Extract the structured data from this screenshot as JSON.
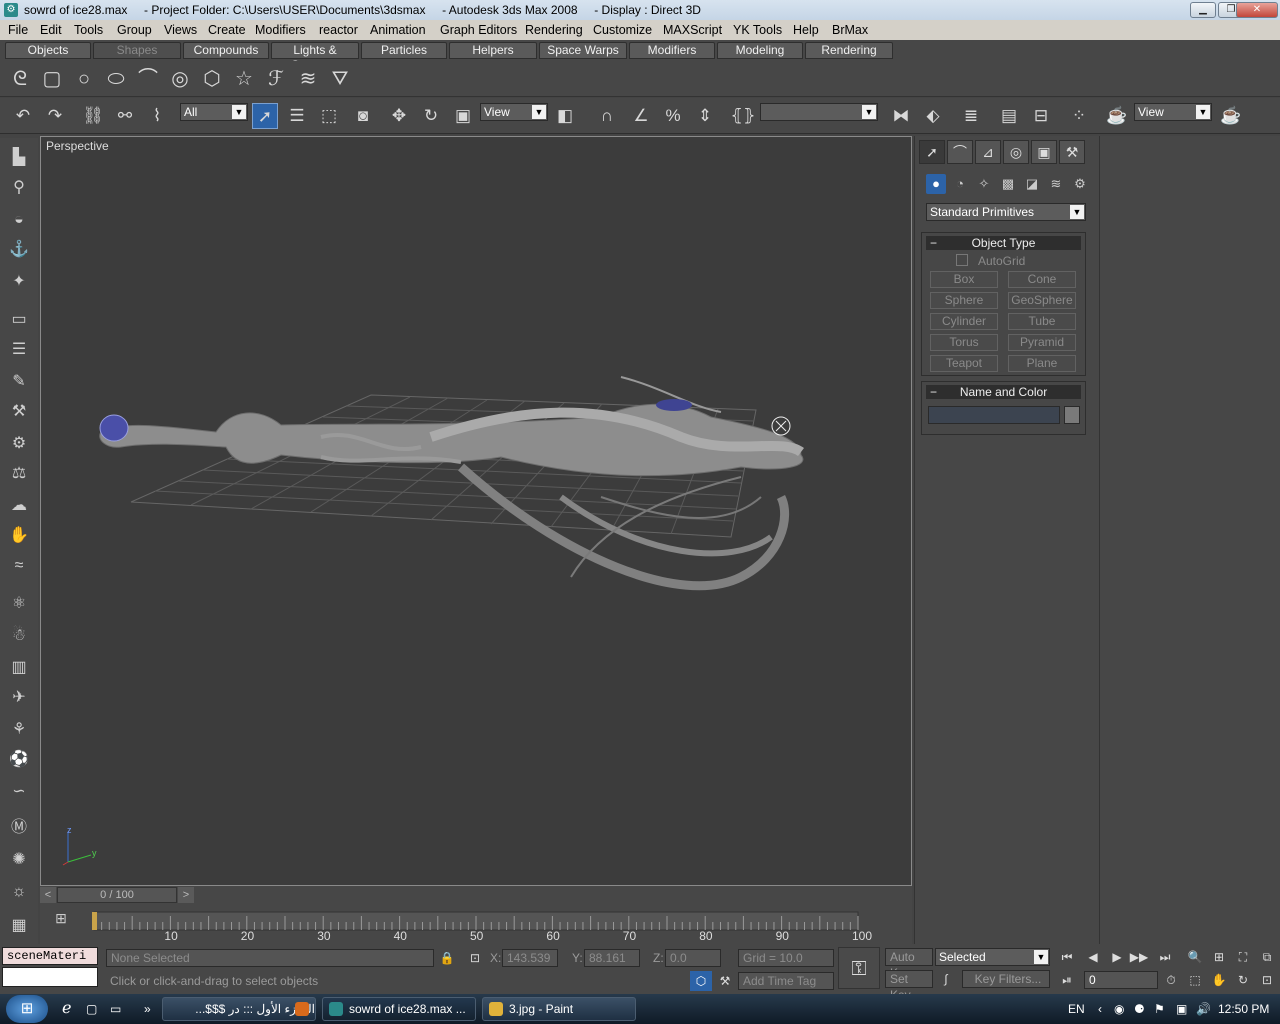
{
  "window": {
    "title": "sowrd of ice28.max     - Project Folder: C:\\Users\\USER\\Documents\\3dsmax     - Autodesk 3ds Max 2008     - Display : Direct 3D",
    "minimize_icon": "minimize-icon",
    "maximize_icon": "restore-icon",
    "close_icon": "close-icon"
  },
  "menu": [
    "File",
    "Edit",
    "Tools",
    "Group",
    "Views",
    "Create",
    "Modifiers",
    "reactor",
    "Animation",
    "Graph Editors",
    "Rendering",
    "Customize",
    "MAXScript",
    "YK Tools",
    "Help",
    "BrMax"
  ],
  "tabs": [
    "Objects",
    "Shapes",
    "Compounds",
    "Lights & Cameras",
    "Particles",
    "Helpers",
    "Space Warps",
    "Modifiers",
    "Modeling",
    "Rendering"
  ],
  "active_tab": "Shapes",
  "toolbar": {
    "selection_filter": "All",
    "ref_coord": "View",
    "named_selection": "",
    "render_view": "View"
  },
  "viewport": {
    "label": "Perspective",
    "axis_x": "y",
    "axis_z": "z"
  },
  "command_panel": {
    "category_dropdown": "Standard Primitives",
    "object_type_title": "Object Type",
    "autogrid_label": "AutoGrid",
    "object_buttons": [
      "Box",
      "Cone",
      "Sphere",
      "GeoSphere",
      "Cylinder",
      "Tube",
      "Torus",
      "Pyramid",
      "Teapot",
      "Plane"
    ],
    "name_color_title": "Name and Color",
    "name_value": "",
    "collapse_symbol": "−"
  },
  "time_slider": {
    "label": "0 / 100",
    "frame_fraction": 0.0
  },
  "track_ticks": [
    "10",
    "20",
    "30",
    "40",
    "50",
    "60",
    "70",
    "80",
    "90",
    "100"
  ],
  "status": {
    "script_label": "sceneMateri",
    "selection_text": "None Selected",
    "prompt": "Click or click-and-drag to select objects",
    "x_label": "X:",
    "x_value": "143.539",
    "y_label": "Y:",
    "y_value": "88.161",
    "z_label": "Z:",
    "z_value": "0.0",
    "grid": "Grid = 10.0",
    "add_time_tag": "Add Time Tag",
    "auto_key": "Auto Key",
    "set_key": "Set Key",
    "key_mode": "Selected",
    "key_filters": "Key Filters...",
    "frame": "0"
  },
  "taskbar": {
    "tasks": [
      "الجـزء الأول ::: در $$$...",
      "sowrd of ice28.max ...",
      "3.jpg - Paint"
    ],
    "lang": "EN",
    "time": "12:50 PM"
  }
}
